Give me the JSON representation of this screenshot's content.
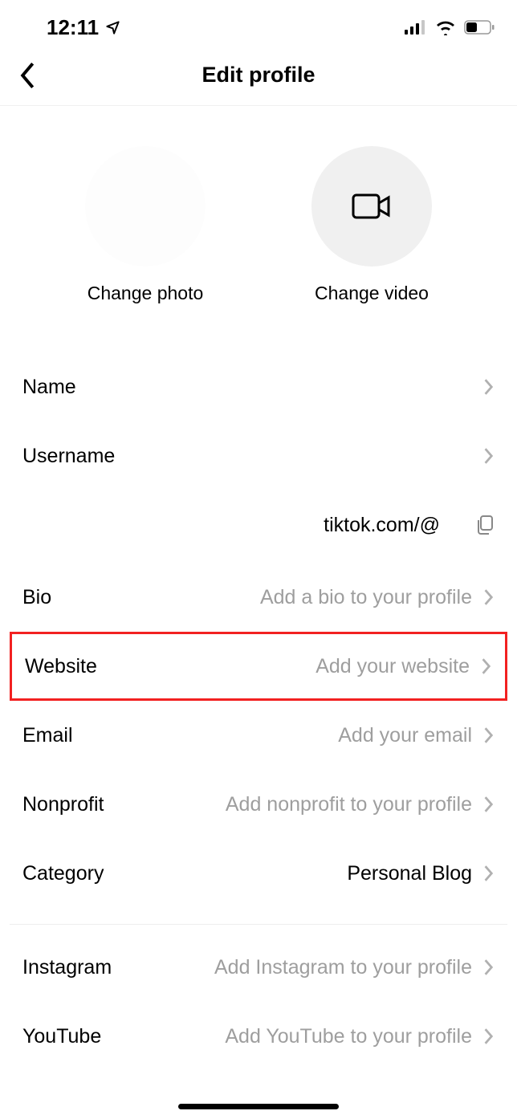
{
  "status": {
    "time": "12:11"
  },
  "header": {
    "title": "Edit profile"
  },
  "media": {
    "photo_caption": "Change photo",
    "video_caption": "Change video"
  },
  "profile_link": {
    "text": "tiktok.com/@"
  },
  "rows": {
    "name": {
      "label": "Name",
      "value": ""
    },
    "username": {
      "label": "Username",
      "value": ""
    },
    "bio": {
      "label": "Bio",
      "value": "Add a bio to your profile"
    },
    "website": {
      "label": "Website",
      "value": "Add your website"
    },
    "email": {
      "label": "Email",
      "value": "Add your email"
    },
    "nonprofit": {
      "label": "Nonprofit",
      "value": "Add nonprofit to your profile"
    },
    "category": {
      "label": "Category",
      "value": "Personal Blog"
    },
    "instagram": {
      "label": "Instagram",
      "value": "Add Instagram to your profile"
    },
    "youtube": {
      "label": "YouTube",
      "value": "Add YouTube to your profile"
    }
  }
}
